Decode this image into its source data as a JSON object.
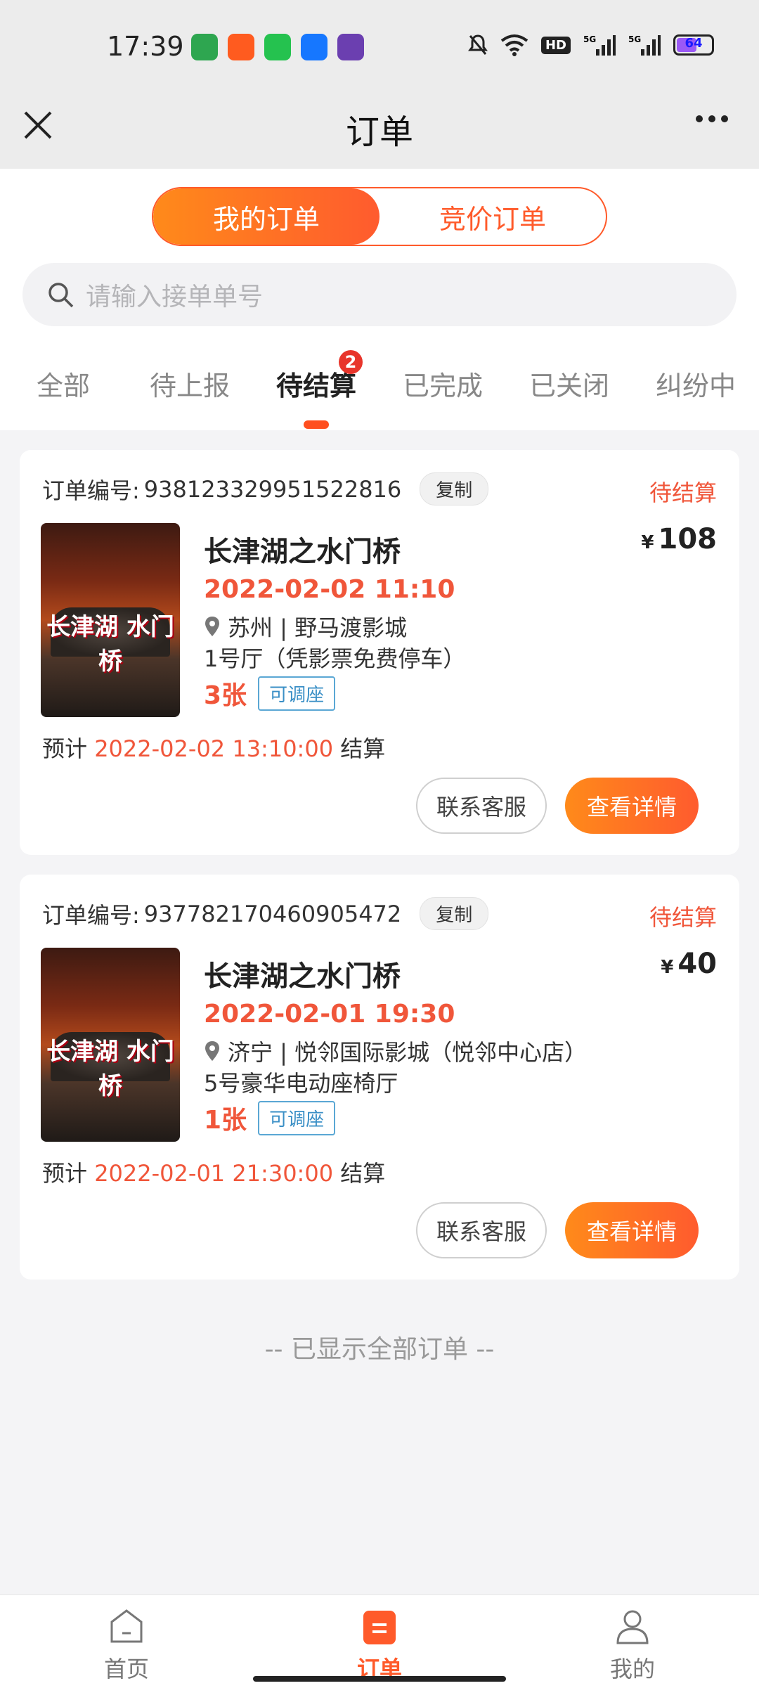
{
  "status_bar": {
    "time": "17:39",
    "battery": "64",
    "hd": "HD"
  },
  "nav": {
    "title": "订单"
  },
  "segments": {
    "mine": "我的订单",
    "bid": "竞价订单"
  },
  "search": {
    "placeholder": "请输入接单单号"
  },
  "tabs": [
    {
      "label": "全部"
    },
    {
      "label": "待上报"
    },
    {
      "label": "待结算",
      "badge": "2"
    },
    {
      "label": "已完成"
    },
    {
      "label": "已关闭"
    },
    {
      "label": "纠纷中"
    }
  ],
  "orders": [
    {
      "order_label": "订单编号:",
      "order_no": "938123329951522816",
      "copy": "复制",
      "status": "待结算",
      "movie": "长津湖之水门桥",
      "price_symbol": "¥",
      "price": "108",
      "showtime": "2022-02-02 11:10",
      "location": "苏州 | 野马渡影城",
      "hall": "1号厅（凭影票免费停车）",
      "tickets": "3张",
      "tag": "可调座",
      "settle_prefix": "预计",
      "settle_time": "2022-02-02 13:10:00",
      "settle_suffix": "结算",
      "btn_service": "联系客服",
      "btn_detail": "查看详情",
      "poster_title": "长津湖 水门桥"
    },
    {
      "order_label": "订单编号:",
      "order_no": "937782170460905472",
      "copy": "复制",
      "status": "待结算",
      "movie": "长津湖之水门桥",
      "price_symbol": "¥",
      "price": "40",
      "showtime": "2022-02-01 19:30",
      "location": "济宁 | 悦邻国际影城（悦邻中心店）",
      "hall": "5号豪华电动座椅厅",
      "tickets": "1张",
      "tag": "可调座",
      "settle_prefix": "预计",
      "settle_time": "2022-02-01 21:30:00",
      "settle_suffix": "结算",
      "btn_service": "联系客服",
      "btn_detail": "查看详情",
      "poster_title": "长津湖 水门桥"
    }
  ],
  "footer_note": "-- 已显示全部订单 --",
  "tabbar": [
    {
      "label": "首页",
      "icon": "home-icon"
    },
    {
      "label": "订单",
      "icon": "order-icon"
    },
    {
      "label": "我的",
      "icon": "profile-icon"
    }
  ],
  "colors": {
    "accent": "#ff5a2a",
    "status": "#f0563a",
    "badge": "#e8352b",
    "tag": "#3a8fc6"
  }
}
